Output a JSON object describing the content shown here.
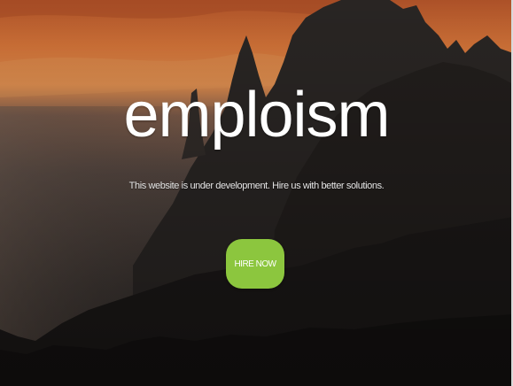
{
  "hero": {
    "brand": "emploism",
    "tagline": "This website is under development. Hire us with better solutions.",
    "cta_label": "HIRE NOW"
  },
  "colors": {
    "accent": "#8cc63e",
    "sky_top": "#c7622a",
    "sky_mid": "#e08a45",
    "mountain_dark": "#1e1a18"
  }
}
